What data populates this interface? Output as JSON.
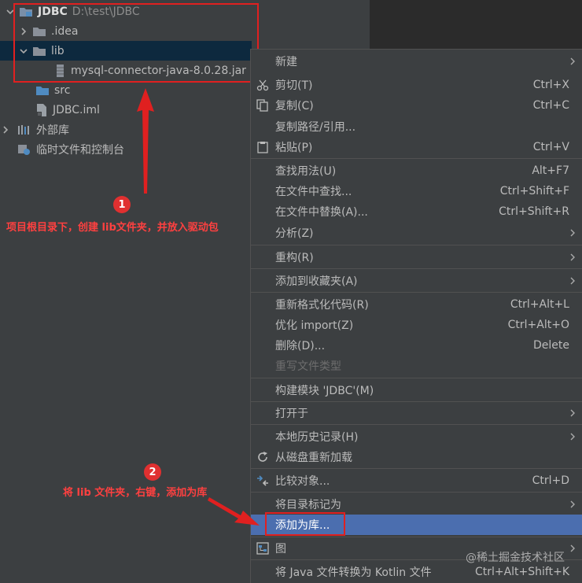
{
  "tree": {
    "root_name": "JDBC",
    "root_path": "D:\\test\\JDBC",
    "idea": ".idea",
    "lib": "lib",
    "jar": "mysql-connector-java-8.0.28.jar",
    "src": "src",
    "iml": "JDBC.iml",
    "external_libs": "外部库",
    "scratches": "临时文件和控制台"
  },
  "annotations": {
    "step1_number": "1",
    "step1_text": "项目根目录下，创建 lib文件夹，并放入驱动包",
    "step2_number": "2",
    "step2_text": "将 lib 文件夹，右键，添加为库"
  },
  "menu": {
    "new": "新建",
    "cut": "剪切(T)",
    "cut_key": "Ctrl+X",
    "copy": "复制(C)",
    "copy_key": "Ctrl+C",
    "copy_path": "复制路径/引用...",
    "paste": "粘贴(P)",
    "paste_key": "Ctrl+V",
    "find_usages": "查找用法(U)",
    "find_usages_key": "Alt+F7",
    "find_in_files": "在文件中查找...",
    "find_in_files_key": "Ctrl+Shift+F",
    "replace_in_files": "在文件中替换(A)...",
    "replace_in_files_key": "Ctrl+Shift+R",
    "analyze": "分析(Z)",
    "refactor": "重构(R)",
    "add_favorites": "添加到收藏夹(A)",
    "reformat": "重新格式化代码(R)",
    "reformat_key": "Ctrl+Alt+L",
    "optimize_imports": "优化 import(Z)",
    "optimize_imports_key": "Ctrl+Alt+O",
    "delete": "删除(D)...",
    "delete_key": "Delete",
    "override_file_type": "重写文件类型",
    "build_module": "构建模块 'JDBC'(M)",
    "open_in": "打开于",
    "local_history": "本地历史记录(H)",
    "reload_from_disk": "从磁盘重新加载",
    "compare_with": "比较对象...",
    "compare_with_key": "Ctrl+D",
    "mark_directory_as": "将目录标记为",
    "add_as_library": "添加为库...",
    "diagrams": "图",
    "convert_kotlin": "将 Java 文件转换为 Kotlin 文件",
    "convert_kotlin_key": "Ctrl+Alt+Shift+K"
  },
  "watermark": "@稀土掘金技术社区",
  "colors": {
    "background": "#3c3f41",
    "highlight": "#4b6eaf",
    "annotation_red": "#e02020",
    "folder_blue": "#4f8bc1"
  }
}
